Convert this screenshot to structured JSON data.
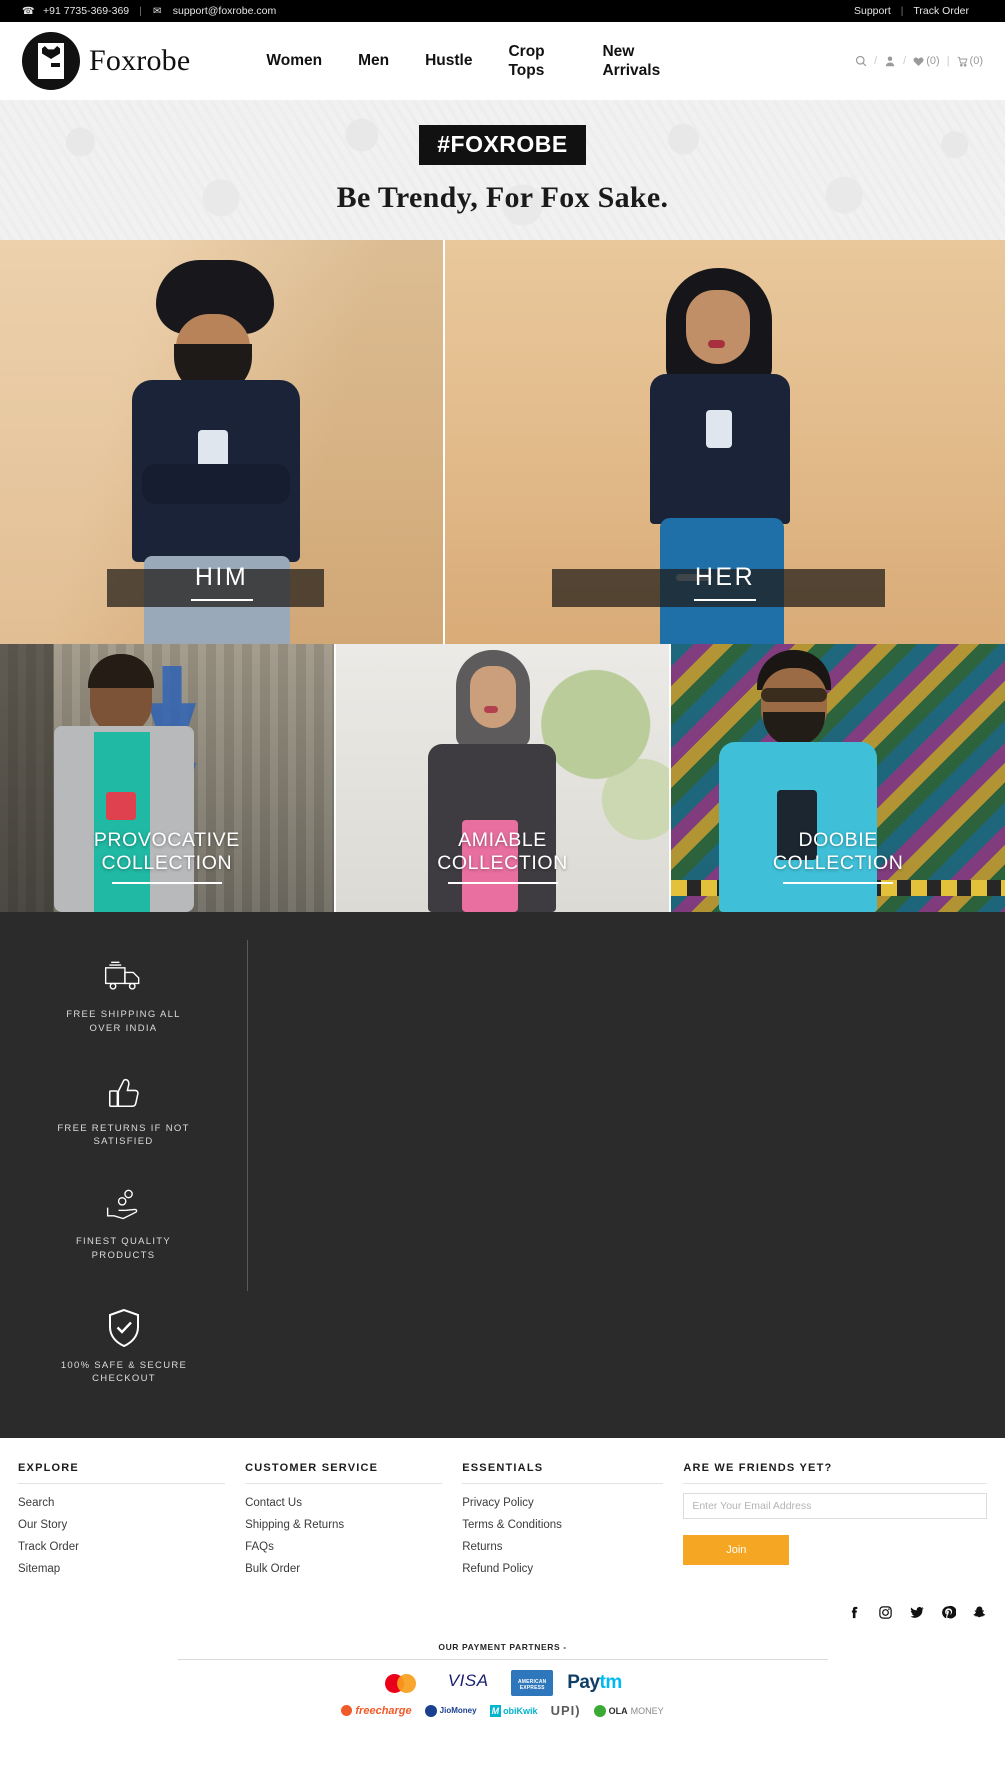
{
  "topbar": {
    "phone": "+91 7735-369-369",
    "phone_icon": "phone-icon",
    "email": "support@foxrobe.com",
    "email_icon": "envelope-icon",
    "divider": "|",
    "support": "Support",
    "track_order": "Track Order"
  },
  "header": {
    "brand": "Foxrobe",
    "nav": [
      {
        "label": "Women"
      },
      {
        "label": "Men"
      },
      {
        "label": "Hustle"
      },
      {
        "label": "Crop Tops"
      },
      {
        "label": "New Arrivals"
      }
    ],
    "icons": {
      "search": "search-icon",
      "account": "user-icon",
      "wishlist_label": "(0)",
      "cart_label": "(0)",
      "slash": "/",
      "pipe": "|"
    }
  },
  "hero": {
    "badge": "#FOXROBE",
    "tagline": "Be Trendy, For Fox Sake."
  },
  "categories": [
    {
      "label": "HIM"
    },
    {
      "label": "HER"
    }
  ],
  "collections": [
    {
      "line1": "PROVOCATIVE",
      "line2": "COLLECTION"
    },
    {
      "line1": "AMIABLE",
      "line2": "COLLECTION"
    },
    {
      "line1": "DOOBIE",
      "line2": "COLLECTION"
    }
  ],
  "features": [
    {
      "icon": "truck-icon",
      "line1": "FREE SHIPPING ALL",
      "line2": "OVER INDIA"
    },
    {
      "icon": "thumbs-up-icon",
      "line1": "FREE RETURNS IF NOT",
      "line2": "SATISFIED"
    },
    {
      "icon": "hand-coins-icon",
      "line1": "FINEST QUALITY",
      "line2": "PRODUCTS"
    },
    {
      "icon": "shield-check-icon",
      "line1": "100% SAFE & SECURE",
      "line2": "CHECKOUT"
    }
  ],
  "footer": {
    "explore": {
      "title": "EXPLORE",
      "links": [
        "Search",
        "Our Story",
        "Track Order",
        "Sitemap"
      ]
    },
    "customer_service": {
      "title": "CUSTOMER SERVICE",
      "links": [
        "Contact Us",
        "Shipping & Returns",
        "FAQs",
        "Bulk Order"
      ]
    },
    "essentials": {
      "title": "ESSENTIALS",
      "links": [
        "Privacy Policy",
        "Terms & Conditions",
        "Returns",
        "Refund Policy"
      ]
    },
    "newsletter": {
      "title": "ARE WE FRIENDS YET?",
      "placeholder": "Enter Your Email Address",
      "value": "",
      "button": "Join"
    },
    "socials": [
      {
        "name": "facebook-icon"
      },
      {
        "name": "instagram-icon"
      },
      {
        "name": "twitter-icon"
      },
      {
        "name": "pinterest-icon"
      },
      {
        "name": "snapchat-icon"
      }
    ]
  },
  "payments": {
    "title": "OUR PAYMENT PARTNERS -",
    "row1": [
      "MasterCard",
      "VISA",
      "American Express",
      "Paytm"
    ],
    "row2": [
      "Freecharge",
      "JioMoney",
      "MobiKwik",
      "UPI",
      "OLA MONEY"
    ],
    "labels": {
      "mastercard": "MasterCard",
      "visa": "VISA",
      "amex_l1": "AMERICAN",
      "amex_l2": "EXPRESS",
      "paytm_a": "Pay",
      "paytm_b": "tm",
      "freecharge": "freecharge",
      "jiomoney": "JioMoney",
      "mobikwik_m": "M",
      "mobikwik_rest": "obiKwik",
      "upi": "UPI)",
      "ola_a": "OLA",
      "ola_b": "MONEY"
    }
  },
  "colors": {
    "accent": "#f5a623",
    "dark": "#2b2b2b",
    "black": "#000000"
  }
}
